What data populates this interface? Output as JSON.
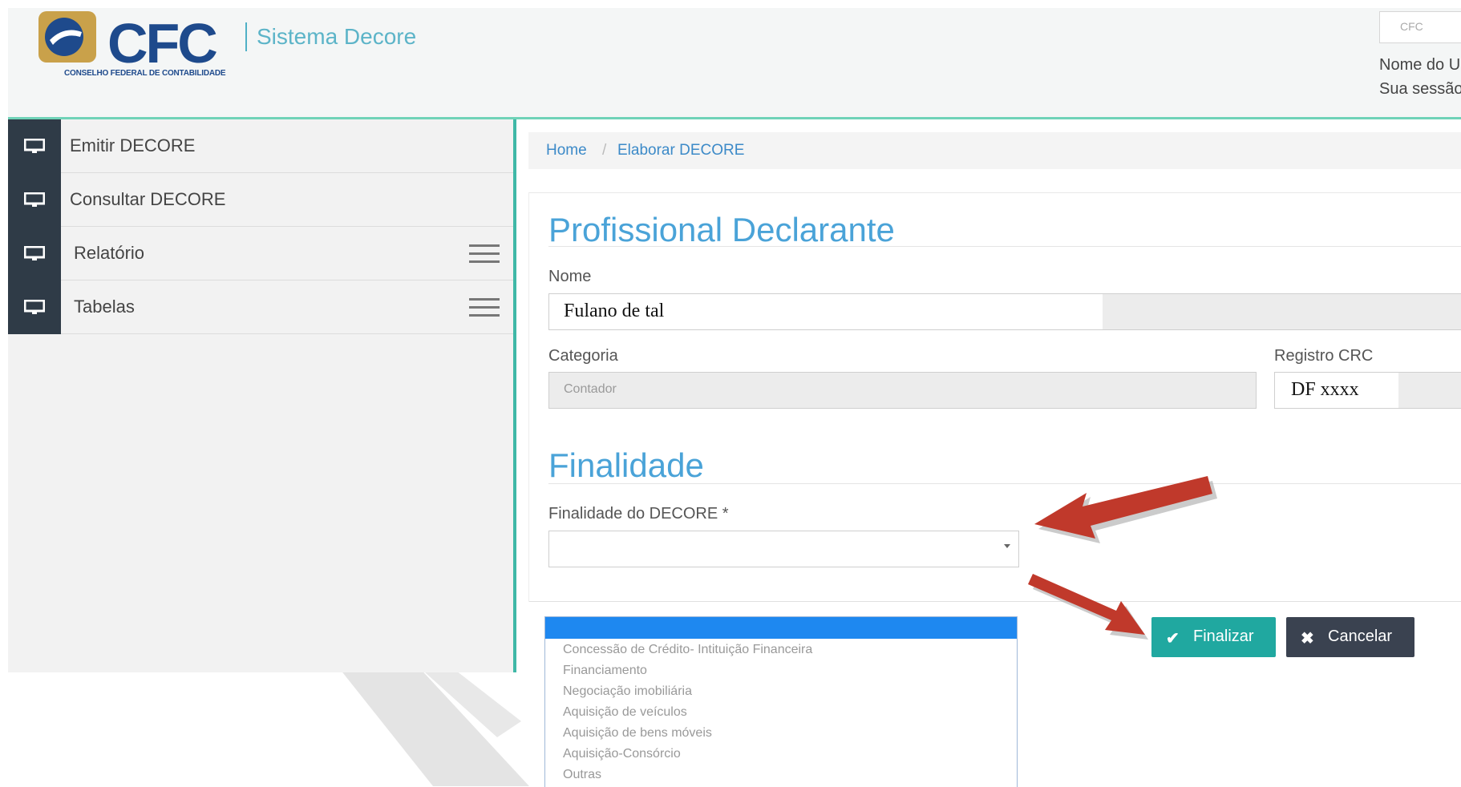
{
  "header": {
    "logo_text": "CFC",
    "logo_subtitle": "CONSELHO FEDERAL DE CONTABILIDADE",
    "system_name": "Sistema Decore",
    "search_placeholder": "CFC",
    "user_name": "Nome do U",
    "session": "Sua sessão"
  },
  "sidebar": {
    "items": [
      {
        "label": "Emitir DECORE",
        "icon": "monitor-icon",
        "has_menu": false
      },
      {
        "label": "Consultar DECORE",
        "icon": "monitor-icon",
        "has_menu": false
      },
      {
        "label": "Relatório",
        "icon": "monitor-icon",
        "has_menu": true
      },
      {
        "label": "Tabelas",
        "icon": "monitor-icon",
        "has_menu": true
      }
    ]
  },
  "breadcrumb": {
    "home": "Home",
    "separator": "/",
    "current": "Elaborar DECORE"
  },
  "profissional": {
    "title": "Profissional Declarante",
    "nome_label": "Nome",
    "nome_value": "Fulano de tal",
    "categoria_label": "Categoria",
    "categoria_value": "Contador",
    "registro_label": "Registro CRC",
    "registro_value": "DF xxxx"
  },
  "finalidade": {
    "title": "Finalidade",
    "label": "Finalidade do DECORE *",
    "selected": "",
    "options": [
      "Concessão de Crédito- Intituição Financeira",
      "Financiamento",
      "Negociação imobiliária",
      "Aquisição de veículos",
      "Aquisição de bens móveis",
      "Aquisição-Consórcio",
      "Outras"
    ]
  },
  "actions": {
    "finalizar_label": "Finalizar",
    "finalizar_icon": "check-icon",
    "cancelar_label": "Cancelar",
    "cancelar_icon": "close-icon"
  },
  "colors": {
    "logo_blue": "#1e4a8c",
    "accent_teal": "#20a8a0",
    "title_blue": "#4aa3d8",
    "dark_button": "#3a4250",
    "annotation_red": "#c0392b"
  }
}
